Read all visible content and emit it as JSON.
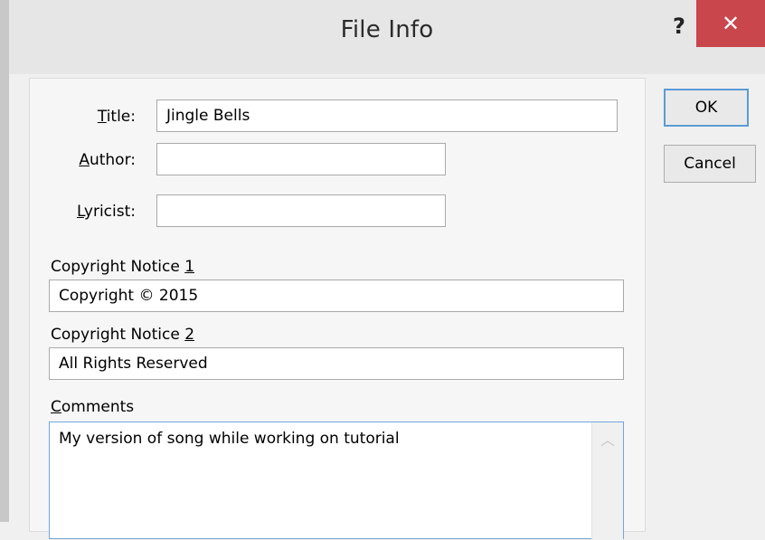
{
  "window": {
    "title": "File Info",
    "help_glyph": "?",
    "close_glyph": "✕"
  },
  "buttons": {
    "ok": "OK",
    "cancel": "Cancel"
  },
  "fields": {
    "title": {
      "label_access": "T",
      "label_rest": "itle:",
      "value": "Jingle Bells"
    },
    "author": {
      "label_access": "A",
      "label_rest": "uthor:",
      "value": ""
    },
    "lyricist": {
      "label_access": "L",
      "label_rest": "yricist:",
      "value": ""
    },
    "copyright1": {
      "label_pre": "Copyright Notice ",
      "label_access": "1",
      "value": "Copyright © 2015"
    },
    "copyright2": {
      "label_pre": "Copyright Notice ",
      "label_access": "2",
      "value": "All Rights Reserved"
    },
    "comments": {
      "label_access": "C",
      "label_rest": "omments",
      "value": "My version of song while working on tutorial"
    }
  },
  "icons": {
    "scroll_up": "chevron-up-icon"
  },
  "colors": {
    "close_button": "#c8464c",
    "focus_border": "#5b9bd5"
  }
}
